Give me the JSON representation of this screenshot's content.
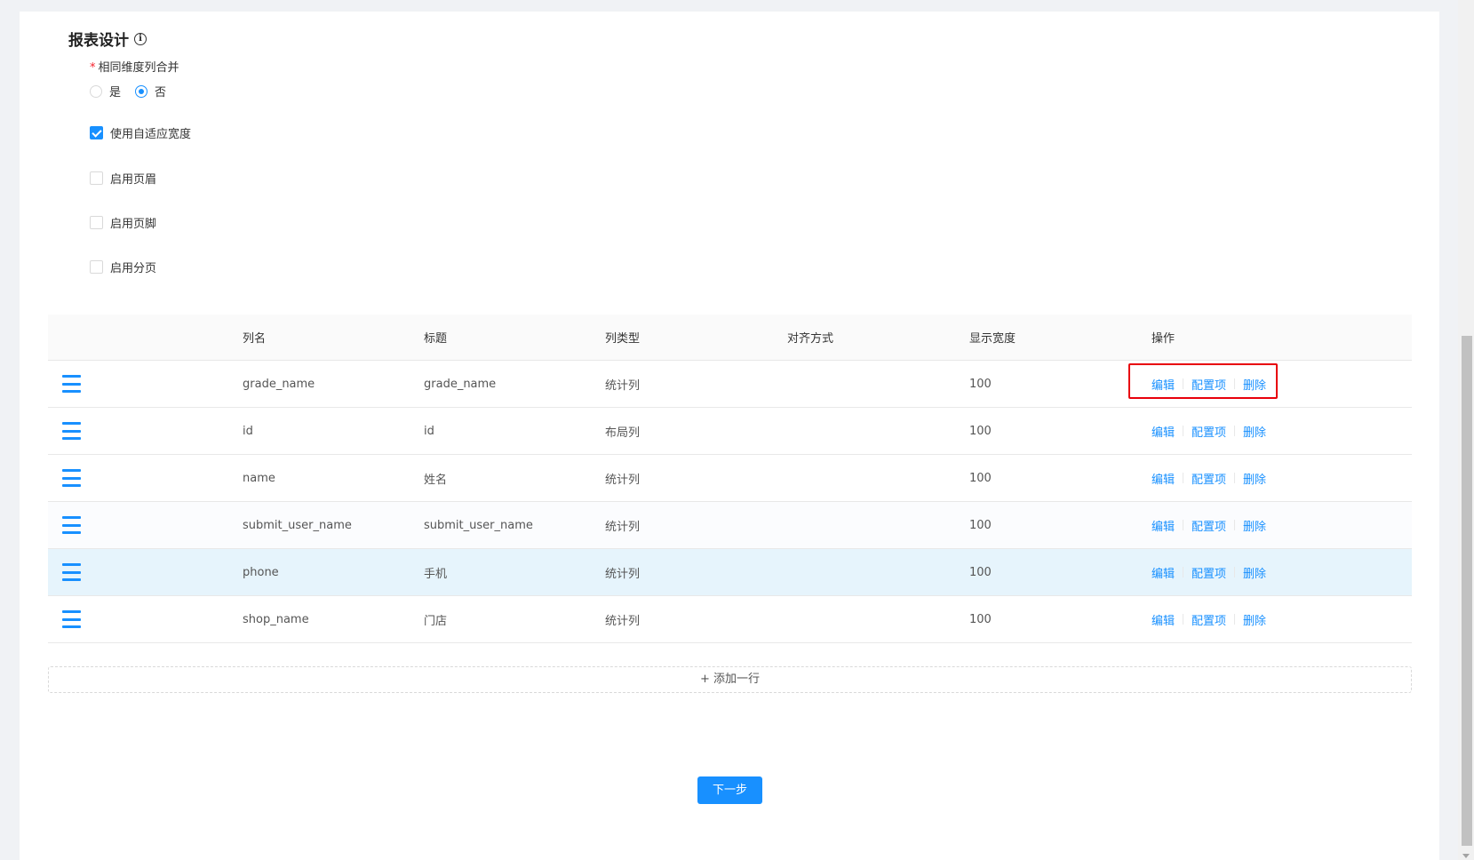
{
  "section": {
    "title": "报表设计"
  },
  "merge_field": {
    "required_mark": "*",
    "label": "相同维度列合并",
    "options": [
      {
        "label": "是",
        "checked": false
      },
      {
        "label": "否",
        "checked": true
      }
    ]
  },
  "checkboxes": [
    {
      "label": "使用自适应宽度",
      "checked": true
    },
    {
      "label": "启用页眉",
      "checked": false
    },
    {
      "label": "启用页脚",
      "checked": false
    },
    {
      "label": "启用分页",
      "checked": false
    }
  ],
  "table": {
    "headers": [
      "",
      "列名",
      "标题",
      "列类型",
      "对齐方式",
      "显示宽度",
      "操作"
    ],
    "rows": [
      {
        "name": "grade_name",
        "title": "grade_name",
        "type": "统计列",
        "align": "",
        "width": "100"
      },
      {
        "name": "id",
        "title": "id",
        "type": "布局列",
        "align": "",
        "width": "100"
      },
      {
        "name": "name",
        "title": "姓名",
        "type": "统计列",
        "align": "",
        "width": "100"
      },
      {
        "name": "submit_user_name",
        "title": "submit_user_name",
        "type": "统计列",
        "align": "",
        "width": "100"
      },
      {
        "name": "phone",
        "title": "手机",
        "type": "统计列",
        "align": "",
        "width": "100"
      },
      {
        "name": "shop_name",
        "title": "门店",
        "type": "统计列",
        "align": "",
        "width": "100"
      }
    ],
    "actions": {
      "edit": "编辑",
      "config": "配置项",
      "delete": "删除"
    }
  },
  "add_row_label": "+ 添加一行",
  "next_button_label": "下一步",
  "colors": {
    "primary": "#1890ff",
    "highlight": "#e8000b",
    "hover_row": "#e6f4fc"
  }
}
